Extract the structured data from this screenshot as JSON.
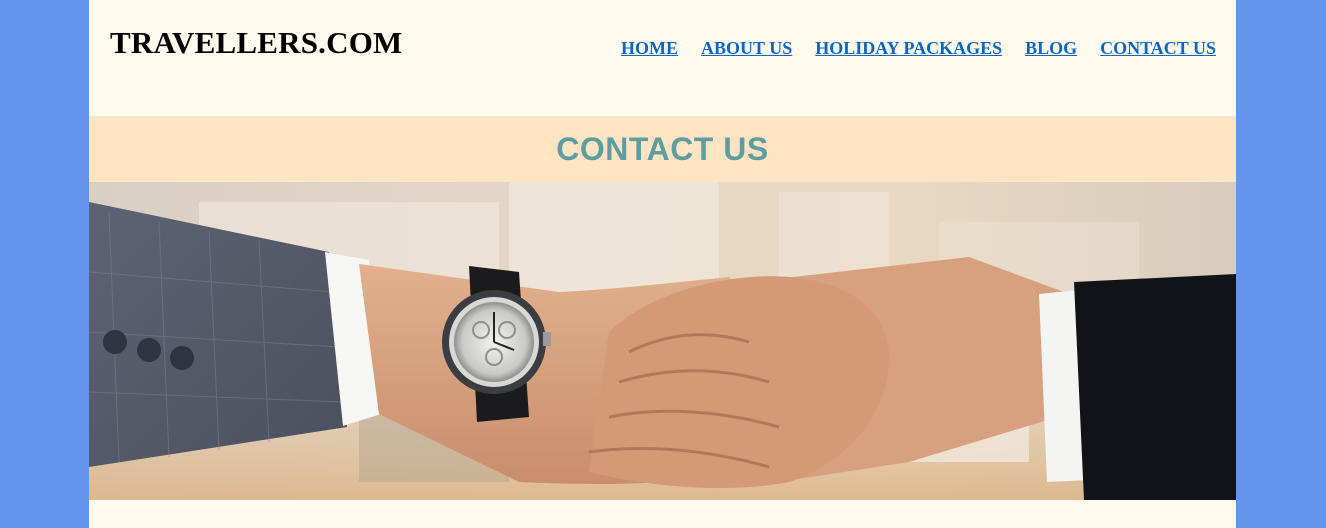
{
  "header": {
    "logo": "TRAVELLERS.COM",
    "nav": [
      {
        "label": "HOME"
      },
      {
        "label": "ABOUT US"
      },
      {
        "label": "HOLIDAY PACKAGES"
      },
      {
        "label": "BLOG"
      },
      {
        "label": "CONTACT US"
      }
    ]
  },
  "banner": {
    "title": "CONTACT US"
  },
  "colors": {
    "page_background": "#6495ed",
    "content_background": "#fffaee",
    "banner_background": "#ffe4c3",
    "banner_text": "#5f9ea0",
    "nav_link": "#0a66c2"
  }
}
